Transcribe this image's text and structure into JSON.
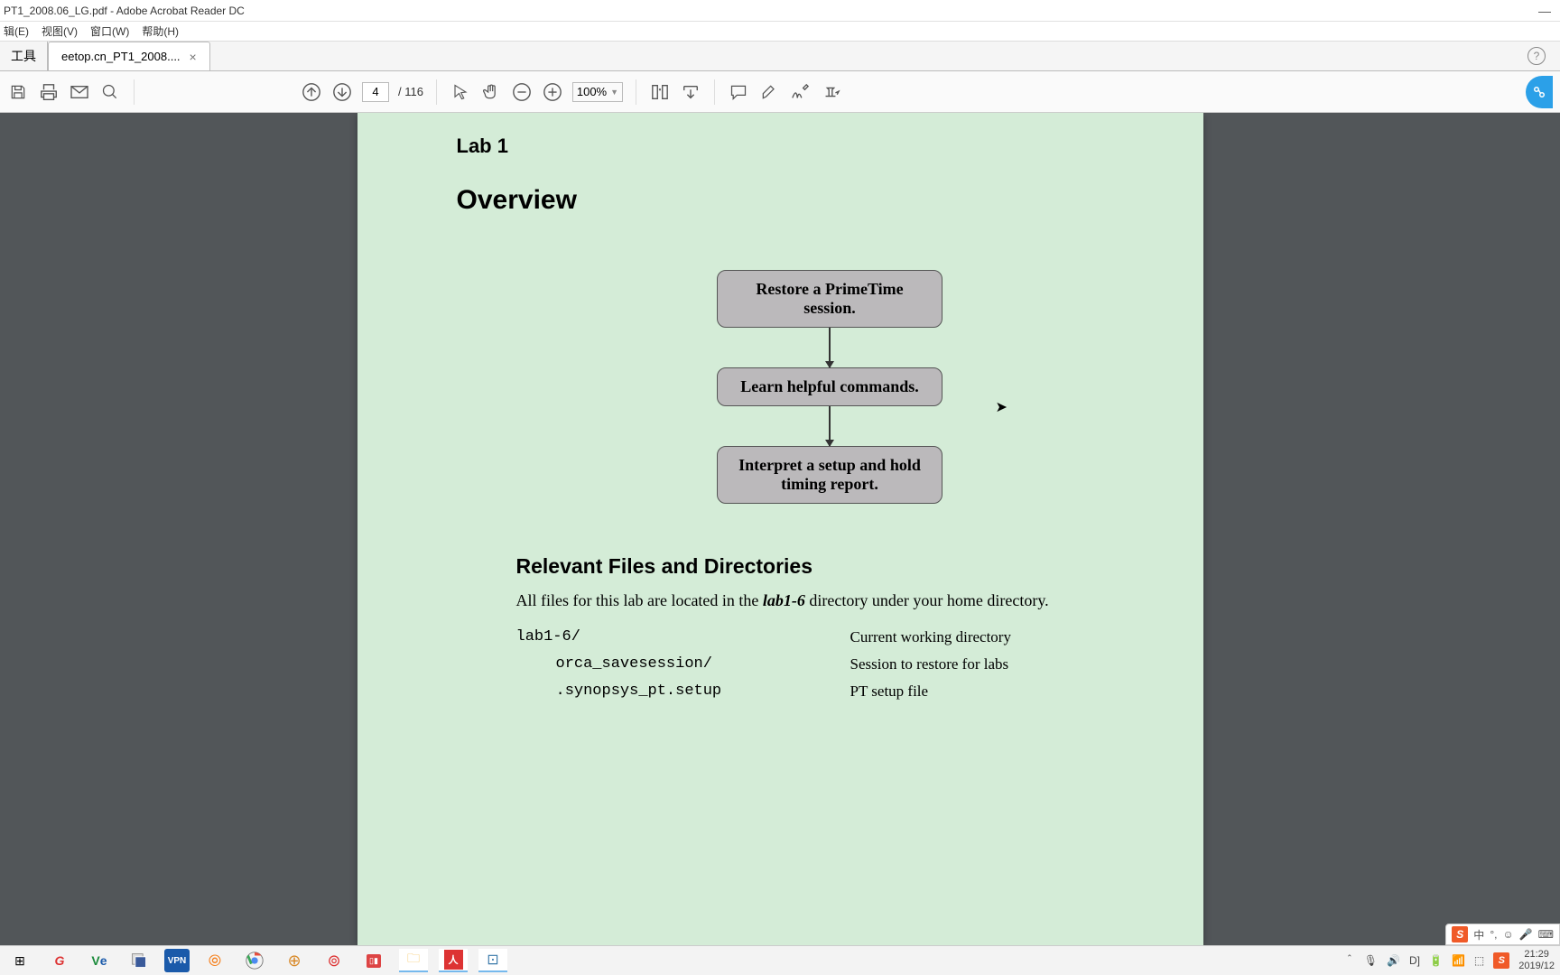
{
  "window": {
    "title": "PT1_2008.06_LG.pdf - Adobe Acrobat Reader DC",
    "minimize": "—"
  },
  "menu": {
    "edit": "辑(E)",
    "view": "视图(V)",
    "window": "窗口(W)",
    "help": "帮助(H)"
  },
  "tabs": {
    "home": "工具",
    "doc": "eetop.cn_PT1_2008....",
    "close": "×",
    "help": "?"
  },
  "toolbar": {
    "page_current": "4",
    "page_total": "/ 116",
    "zoom": "100%"
  },
  "doc": {
    "lab": "Lab 1",
    "overview": "Overview",
    "box1": "Restore a PrimeTime session.",
    "box2": "Learn helpful commands.",
    "box3": "Interpret a setup and hold timing report.",
    "section": "Relevant Files and Directories",
    "body_pre": "All files for this lab are located in the ",
    "body_em": "lab1-6",
    "body_post": "  directory under your home directory.",
    "files": [
      {
        "name": "lab1-6/",
        "desc": "Current working directory",
        "indent": ""
      },
      {
        "name": "orca_savesession/",
        "desc": "Session to restore for labs",
        "indent": "indent1"
      },
      {
        "name": ".synopsys_pt.setup",
        "desc": "PT setup file",
        "indent": "indent1"
      }
    ]
  },
  "ime": {
    "lang": "中",
    "punct": "°,",
    "smile": "☺",
    "mic": "🎤",
    "kb": "⌨"
  },
  "tray": {
    "chevron": "＾",
    "mic": "🎙",
    "vol": "🔊",
    "d": "D]",
    "bat": "🔋",
    "wifi": "📶",
    "pin": "⬚",
    "s_label": "S",
    "time": "21:29",
    "date": "2019/12"
  }
}
